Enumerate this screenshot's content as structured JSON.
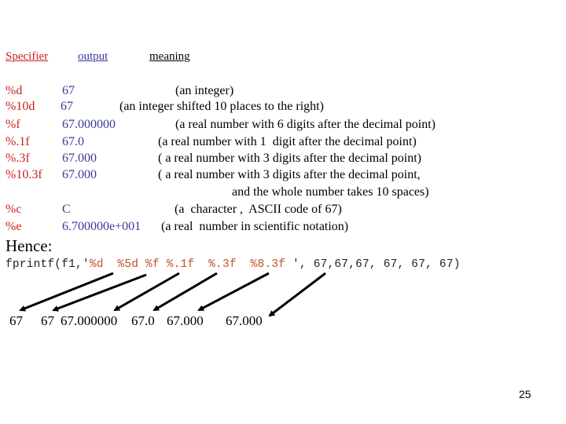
{
  "header": {
    "specifier": "Specifier",
    "output": "output",
    "meaning": "meaning",
    "colors": {
      "specifier": "#cc1f1f",
      "output": "#3a3a9a",
      "meaning": "#000000"
    }
  },
  "rows": [
    {
      "spec": "%d",
      "output": "67",
      "meaning": "(an integer)"
    },
    {
      "spec": "%10d",
      "output": "67",
      "meaning": "(an integer shifted 10 places to the right)"
    },
    {
      "spec": "%f",
      "output": "67.000000",
      "meaning": "(a real number with 6 digits after the decimal point)"
    },
    {
      "spec": "%.1f",
      "output": "67.0",
      "meaning": "(a real number with 1  digit after the decimal point)"
    },
    {
      "spec": "%.3f",
      "output": "67.000",
      "meaning": "( a real number with 3 digits after the decimal point)"
    },
    {
      "spec": "%10.3f",
      "output": "67.000",
      "meaning": "( a real number with 3 digits after the decimal point,",
      "meaning_cont": "and the whole number takes 10 spaces)"
    },
    {
      "spec": "%c",
      "output": "C",
      "meaning": "(a  character ,  ASCII code of 67)"
    },
    {
      "spec": "%e",
      "output": "6.700000e+001",
      "meaning": "(a real  number in scientific notation)"
    }
  ],
  "hence": {
    "label": "Hence:",
    "code_prefix": "fprintf(f1,'",
    "code_format": "%d  %5d %f %.1f  %.3f  %8.3f ",
    "code_suffix": "', 67,67,67, 67, 67, 67)",
    "format_color": "#c0502a"
  },
  "results": [
    "67",
    "67",
    "67.000000",
    "67.0",
    "67.000",
    "67.000"
  ],
  "page_number": "25"
}
